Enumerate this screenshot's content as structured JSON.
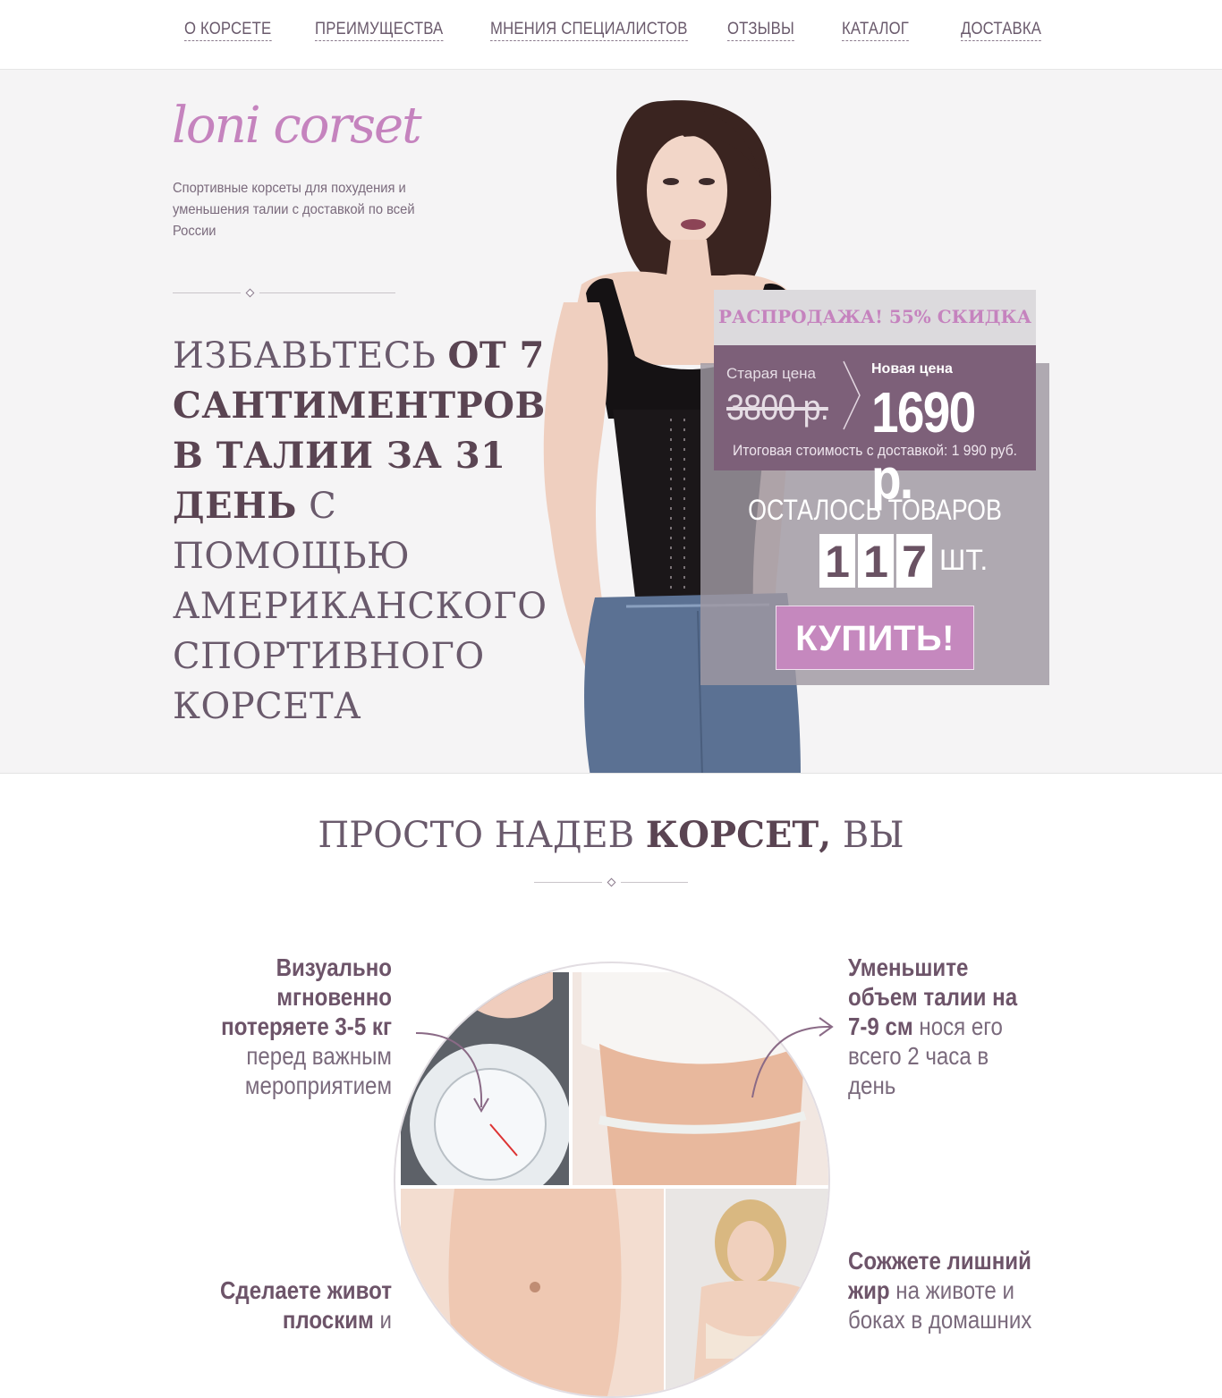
{
  "nav": {
    "items": [
      "О КОРСЕТЕ",
      "ПРЕИМУЩЕСТВА",
      "МНЕНИЯ СПЕЦИАЛИСТОВ",
      "ОТЗЫВЫ",
      "КАТАЛОГ",
      "ДОСТАВКА"
    ]
  },
  "hero": {
    "logo": "loni corset",
    "tagline": "Спортивные корсеты для похудения и уменьшения талии с доставкой по всей России",
    "headline": {
      "part1": "ИЗБАВЬТЕСЬ ",
      "part2_bold": "ОТ 7 САНТИМЕНТРОВ В ТАЛИИ ЗА 31 ДЕНЬ",
      "part3": " С ПОМОЩЬЮ АМЕРИКАНСКОГО СПОРТИВНОГО КОРСЕТА"
    }
  },
  "offer": {
    "sale": "РАСПРОДАЖА! 55% СКИДКА",
    "old_label": "Старая цена",
    "old_price": "3800 р.",
    "new_label": "Новая цена",
    "new_price": "1690 р.",
    "total": "Итоговая стоимость с доставкой: 1 990 руб.",
    "left_label": "ОСТАЛОСЬ ТОВАРОВ",
    "digits": [
      "1",
      "1",
      "7"
    ],
    "unit": "ШТ.",
    "buy_label": "КУПИТЬ!"
  },
  "section2": {
    "title_light": "ПРОСТО НАДЕВ ",
    "title_bold": "КОРСЕТ,",
    "title_end": " ВЫ",
    "benefits": [
      {
        "bold": "Визуально мгновенно потеряете 3-5 кг",
        "text": " перед важным мероприятием"
      },
      {
        "bold": "Уменьшите объем талии на 7-9 см",
        "text": " нося его всего 2 часа в день"
      },
      {
        "bold": "Сделаете живот плоским",
        "text": " и"
      },
      {
        "bold": "Сожжете лишний жир",
        "text": " на животе и боках в домашних"
      }
    ]
  },
  "colors": {
    "accent": "#c583be",
    "plum": "#7d6079",
    "dark_text": "#5a4452"
  }
}
